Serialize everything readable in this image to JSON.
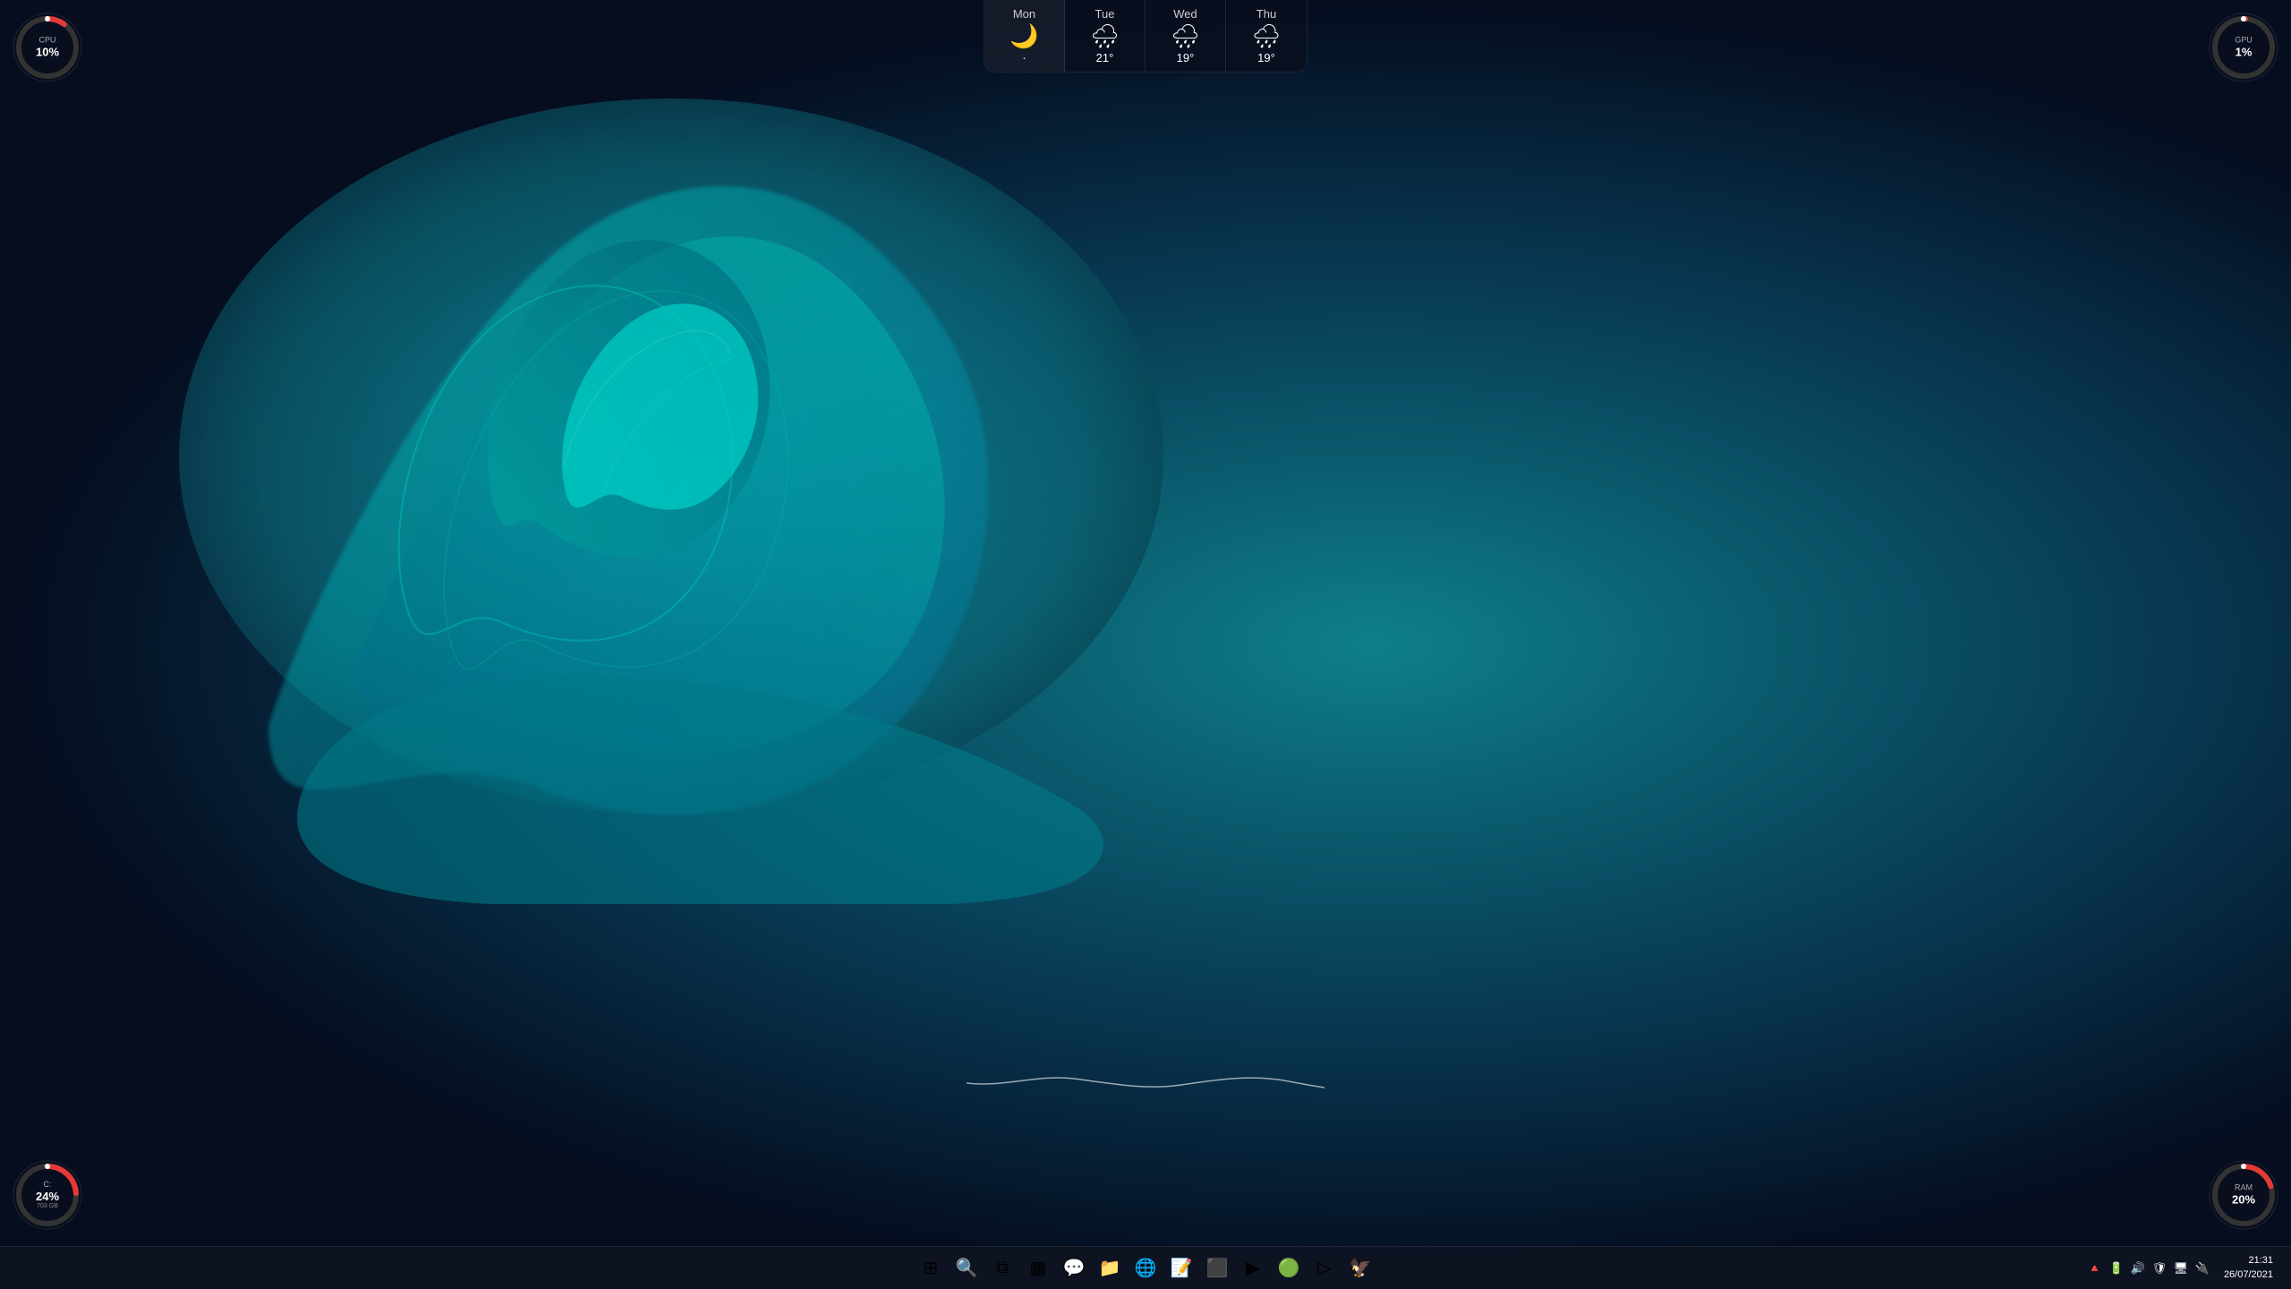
{
  "desktop": {
    "background_color_start": "#050d1f",
    "background_color_mid": "#0a5c6e"
  },
  "weather": {
    "days": [
      {
        "id": "mon",
        "name": "Mon",
        "temp": "·",
        "icon": "🌙",
        "active": true
      },
      {
        "id": "tue",
        "name": "Tue",
        "temp": "21°",
        "icon": "🌧",
        "active": false
      },
      {
        "id": "wed",
        "name": "Wed",
        "temp": "19°",
        "icon": "🌧",
        "active": false
      },
      {
        "id": "thu",
        "name": "Thu",
        "temp": "19°",
        "icon": "🌧",
        "active": false
      }
    ]
  },
  "gauges": {
    "cpu": {
      "label": "CPU",
      "value": "10%",
      "percentage": 10,
      "color": "#e53935"
    },
    "gpu": {
      "label": "GPU",
      "value": "1%",
      "percentage": 1,
      "color": "#e53935"
    },
    "disk": {
      "label": "C:",
      "value": "24%",
      "sublabel": "703 GB",
      "percentage": 24,
      "color": "#e53935"
    },
    "ram": {
      "label": "RAM",
      "value": "20%",
      "percentage": 20,
      "color": "#e53935"
    }
  },
  "taskbar": {
    "icons": [
      {
        "id": "start",
        "icon": "⊞",
        "label": "Start"
      },
      {
        "id": "search",
        "icon": "🔍",
        "label": "Search"
      },
      {
        "id": "taskview",
        "icon": "⧉",
        "label": "Task View"
      },
      {
        "id": "widgets",
        "icon": "▦",
        "label": "Widgets"
      },
      {
        "id": "chat",
        "icon": "💬",
        "label": "Chat"
      },
      {
        "id": "explorer",
        "icon": "📁",
        "label": "File Explorer"
      },
      {
        "id": "chrome",
        "icon": "🌐",
        "label": "Chrome"
      },
      {
        "id": "notes",
        "icon": "📝",
        "label": "Notes"
      },
      {
        "id": "terminal",
        "icon": "⬛",
        "label": "Terminal"
      },
      {
        "id": "youtube",
        "icon": "▶",
        "label": "YouTube"
      },
      {
        "id": "app1",
        "icon": "🟢",
        "label": "App"
      },
      {
        "id": "media",
        "icon": "▷",
        "label": "Media"
      },
      {
        "id": "app2",
        "icon": "🦅",
        "label": "App2"
      }
    ],
    "tray_icons": [
      "🔺",
      "🔋",
      "🔊",
      "🛡",
      "🖥",
      "🔌"
    ],
    "clock": {
      "time": "21:31",
      "date": "26/07/2021"
    }
  }
}
